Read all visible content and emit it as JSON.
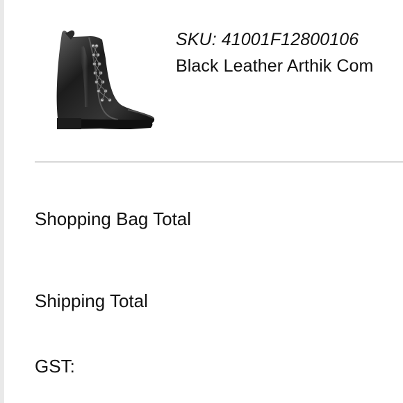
{
  "product": {
    "image_icon": "black-leather-boot-image",
    "sku": "SKU: 41001F12800106",
    "name": "Black Leather Arthik Com"
  },
  "summary": {
    "bag_total_label": "Shopping Bag Total",
    "shipping_total_label": "Shipping Total",
    "gst_label": "GST:"
  },
  "colors": {
    "background": "#ffffff",
    "text": "#111111",
    "divider": "#d7d7d7",
    "left_border": "#e9e9e9"
  }
}
